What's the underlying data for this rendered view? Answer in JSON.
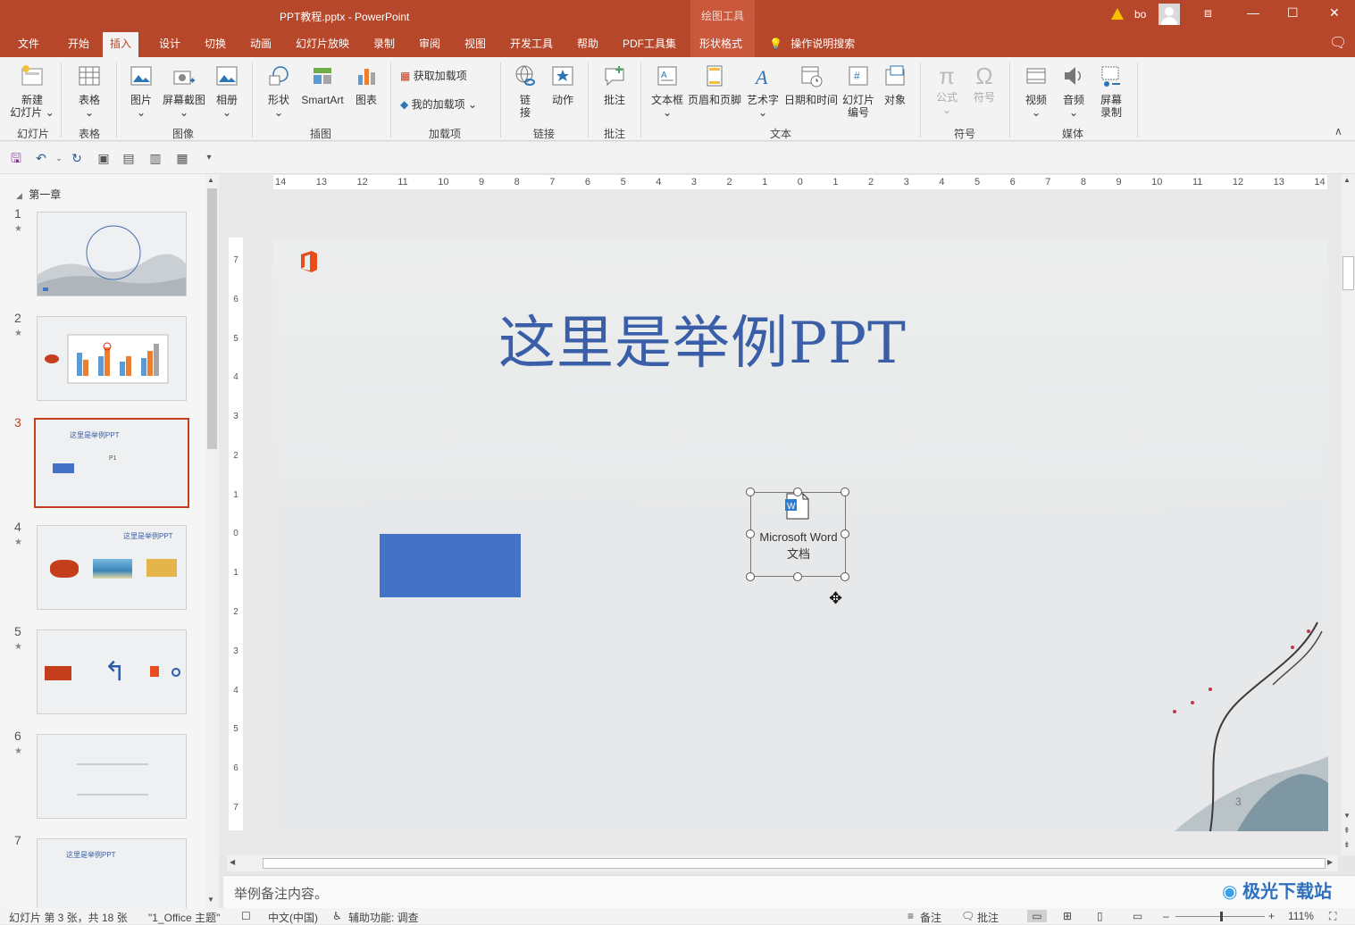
{
  "window": {
    "title": "PPT教程.pptx  -  PowerPoint",
    "context_header": "绘图工具",
    "user": "bo",
    "controls": [
      "⧈",
      "—",
      "☐",
      "✕"
    ]
  },
  "tabs": [
    {
      "label": "文件"
    },
    {
      "label": "开始"
    },
    {
      "label": "插入"
    },
    {
      "label": "设计"
    },
    {
      "label": "切换"
    },
    {
      "label": "动画"
    },
    {
      "label": "幻灯片放映"
    },
    {
      "label": "录制"
    },
    {
      "label": "审阅"
    },
    {
      "label": "视图"
    },
    {
      "label": "开发工具"
    },
    {
      "label": "帮助"
    },
    {
      "label": "PDF工具集"
    },
    {
      "label": "形状格式"
    }
  ],
  "search": {
    "label": "操作说明搜索"
  },
  "ribbon": {
    "buttons": [
      {
        "label": "新建\n幻灯片 ⌄",
        "icon": "new-slide-icon"
      },
      {
        "label": "表格\n⌄",
        "icon": "table-icon"
      },
      {
        "label": "图片\n⌄",
        "icon": "picture-icon"
      },
      {
        "label": "屏幕截图\n⌄",
        "icon": "screenshot-icon"
      },
      {
        "label": "相册\n⌄",
        "icon": "album-icon"
      },
      {
        "label": "形状\n⌄",
        "icon": "shapes-icon"
      },
      {
        "label": "SmartArt",
        "icon": "smartart-icon"
      },
      {
        "label": "图表",
        "icon": "chart-icon"
      },
      {
        "label": "链\n接",
        "icon": "link-icon"
      },
      {
        "label": "动作",
        "icon": "action-icon"
      },
      {
        "label": "批注",
        "icon": "comment-icon"
      },
      {
        "label": "文本框\n⌄",
        "icon": "textbox-icon"
      },
      {
        "label": "页眉和页脚",
        "icon": "header-footer-icon"
      },
      {
        "label": "艺术字\n⌄",
        "icon": "wordart-icon"
      },
      {
        "label": "日期和时间",
        "icon": "datetime-icon"
      },
      {
        "label": "幻灯片\n编号",
        "icon": "slide-number-icon"
      },
      {
        "label": "对象",
        "icon": "object-icon"
      },
      {
        "label": "公式\n⌄",
        "icon": "equation-icon"
      },
      {
        "label": "符号",
        "icon": "symbol-icon"
      },
      {
        "label": "视频\n⌄",
        "icon": "video-icon"
      },
      {
        "label": "音频\n⌄",
        "icon": "audio-icon"
      },
      {
        "label": "屏幕\n录制",
        "icon": "screen-record-icon"
      }
    ],
    "addins": {
      "get": "获取加载项",
      "mine": "我的加载项"
    },
    "groups": [
      "幻灯片",
      "表格",
      "图像",
      "插图",
      "加载项",
      "链接",
      "批注",
      "文本",
      "符号",
      "媒体"
    ]
  },
  "section": {
    "label": "第一章"
  },
  "thumbnails": [
    {
      "num": "1"
    },
    {
      "num": "2"
    },
    {
      "num": "3"
    },
    {
      "num": "4"
    },
    {
      "num": "5"
    },
    {
      "num": "6"
    },
    {
      "num": "7"
    }
  ],
  "thumb_text": {
    "t3_title": "这里是举例PPT",
    "t3_label": "P1",
    "t4_title": "这里是举例PPT",
    "t7_title": "这里是举例PPT"
  },
  "ruler": {
    "h_ticks": [
      "14",
      "13",
      "12",
      "11",
      "10",
      "9",
      "8",
      "7",
      "6",
      "5",
      "4",
      "3",
      "2",
      "1",
      "0",
      "1",
      "2",
      "3",
      "4",
      "5",
      "6",
      "7",
      "8",
      "9",
      "10",
      "11",
      "12",
      "13",
      "14"
    ],
    "v_ticks": [
      "7",
      "6",
      "5",
      "4",
      "3",
      "2",
      "1",
      "0",
      "1",
      "2",
      "3",
      "4",
      "5",
      "6",
      "7"
    ]
  },
  "slide": {
    "title": "这里是举例PPT",
    "object_label": "Microsoft Word\n文档",
    "page_number": "3"
  },
  "notes": {
    "text": "举例备注内容。"
  },
  "status": {
    "slide_info": "幻灯片 第 3 张，共 18 张",
    "theme": "\"1_Office 主题\"",
    "language": "中文(中国)",
    "accessibility": "辅助功能: 调查",
    "notes": "备注",
    "comments": "批注",
    "zoom": "111%"
  },
  "watermark": {
    "text": "极光下载站"
  },
  "colors": {
    "accent": "#b7472a",
    "slide_title": "#3a5ea8",
    "shape_fill": "#4472c4"
  }
}
